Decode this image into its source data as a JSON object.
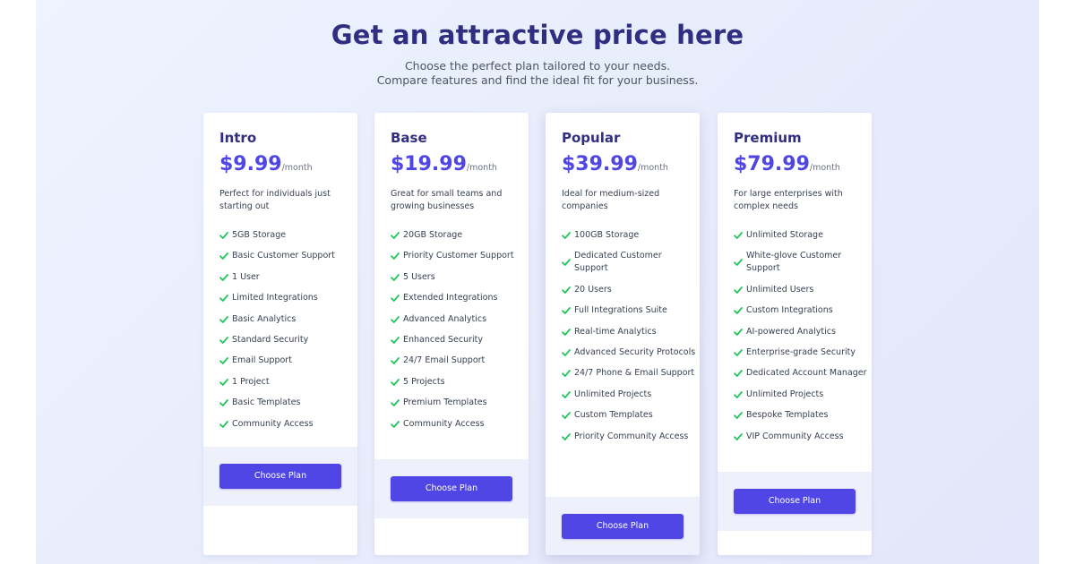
{
  "header": {
    "title": "Get an attractive price here",
    "subtitle_line1": "Choose the perfect plan tailored to your needs.",
    "subtitle_line2": "Compare features and find the ideal fit for your business."
  },
  "colors": {
    "heading": "#312e81",
    "accent": "#4f46e5",
    "check": "#22c55e",
    "footer_band": "#eef1fb"
  },
  "plans": [
    {
      "name": "Intro",
      "price": "$9.99",
      "period": "/month",
      "description": "Perfect for individuals just starting out",
      "features": [
        "5GB Storage",
        "Basic Customer Support",
        "1 User",
        "Limited Integrations",
        "Basic Analytics",
        "Standard Security",
        "Email Support",
        "1 Project",
        "Basic Templates",
        "Community Access"
      ],
      "button": "Choose Plan"
    },
    {
      "name": "Base",
      "price": "$19.99",
      "period": "/month",
      "description": "Great for small teams and growing businesses",
      "features": [
        "20GB Storage",
        "Priority Customer Support",
        "5 Users",
        "Extended Integrations",
        "Advanced Analytics",
        "Enhanced Security",
        "24/7 Email Support",
        "5 Projects",
        "Premium Templates",
        "Community Access"
      ],
      "button": "Choose Plan"
    },
    {
      "name": "Popular",
      "price": "$39.99",
      "period": "/month",
      "description": "Ideal for medium-sized companies",
      "features": [
        "100GB Storage",
        "Dedicated Customer Support",
        "20 Users",
        "Full Integrations Suite",
        "Real-time Analytics",
        "Advanced Security Protocols",
        "24/7 Phone & Email Support",
        "Unlimited Projects",
        "Custom Templates",
        "Priority Community Access"
      ],
      "button": "Choose Plan"
    },
    {
      "name": "Premium",
      "price": "$79.99",
      "period": "/month",
      "description": "For large enterprises with complex needs",
      "features": [
        "Unlimited Storage",
        "White-glove Customer Support",
        "Unlimited Users",
        "Custom Integrations",
        "AI-powered Analytics",
        "Enterprise-grade Security",
        "Dedicated Account Manager",
        "Unlimited Projects",
        "Bespoke Templates",
        "VIP Community Access"
      ],
      "button": "Choose Plan"
    }
  ]
}
